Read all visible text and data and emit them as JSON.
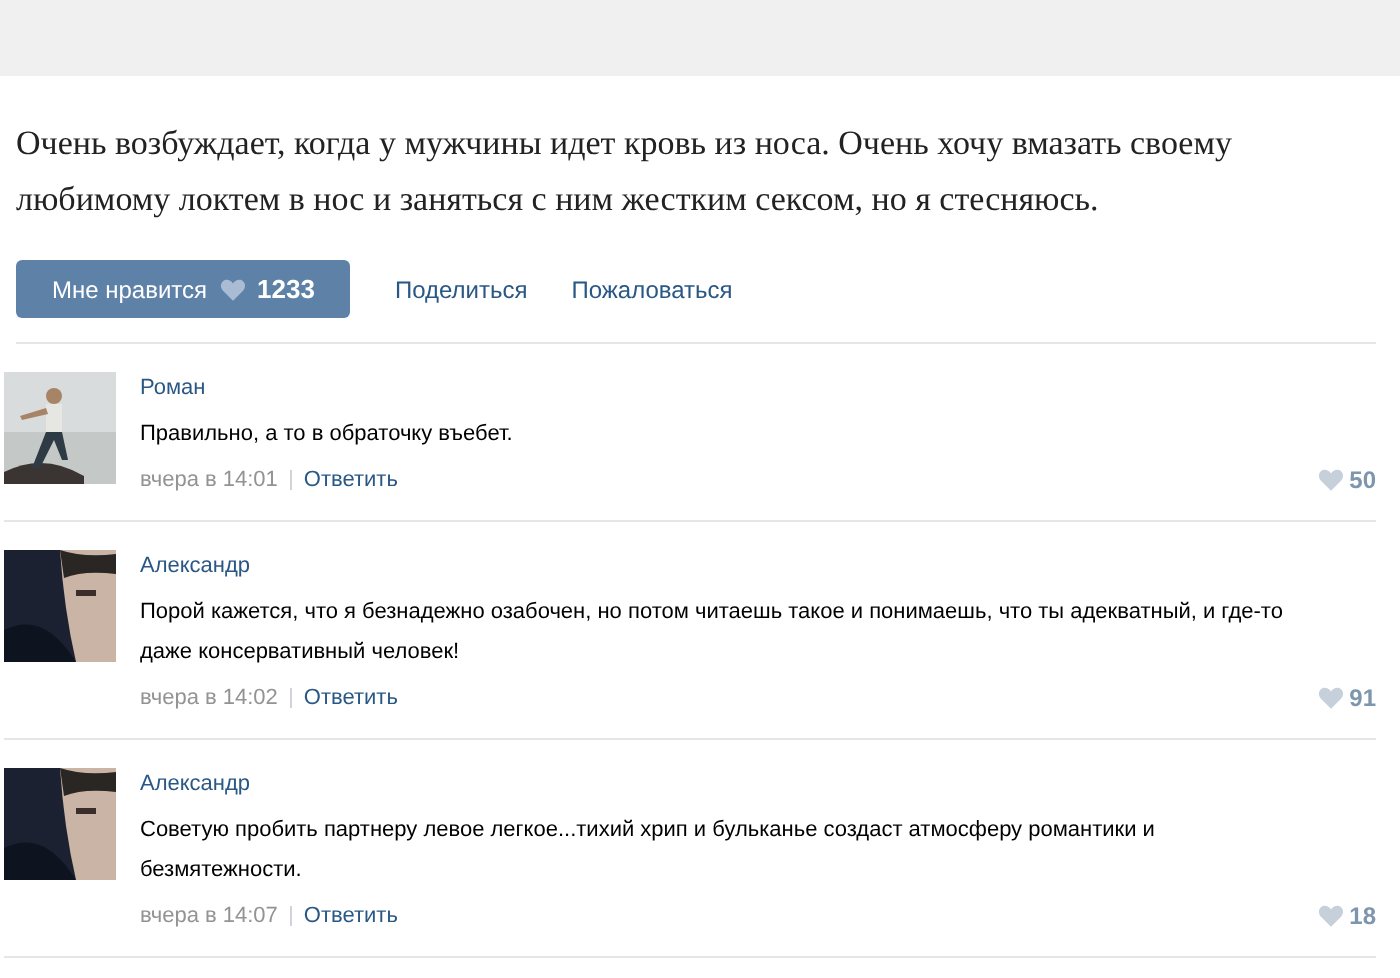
{
  "post": {
    "text": "Очень возбуждает, когда у мужчины идет кровь из носа. Очень хочу вмазать своему любимому локтем в нос и заняться с ним жестким сексом, но я стесняюсь."
  },
  "actions": {
    "like": {
      "label": "Мне нравится",
      "count": "1233"
    },
    "share": "Поделиться",
    "report": "Пожаловаться"
  },
  "comments": [
    {
      "author": "Роман",
      "text": "Правильно, а то в обраточку въебет.",
      "time": "вчера в 14:01",
      "reply": "Ответить",
      "likes": "50"
    },
    {
      "author": "Александр",
      "text": "Порой кажется, что я безнадежно озабочен, но потом читаешь такое и понимаешь, что ты адекватный, и где-то даже консервативный человек!",
      "time": "вчера в 14:02",
      "reply": "Ответить",
      "likes": "91"
    },
    {
      "author": "Александр",
      "text": "Советую пробить партнеру левое легкое...тихий хрип и бульканье создаст атмосферу романтики и безмятежности.",
      "time": "вчера в 14:07",
      "reply": "Ответить",
      "likes": "18"
    }
  ]
}
